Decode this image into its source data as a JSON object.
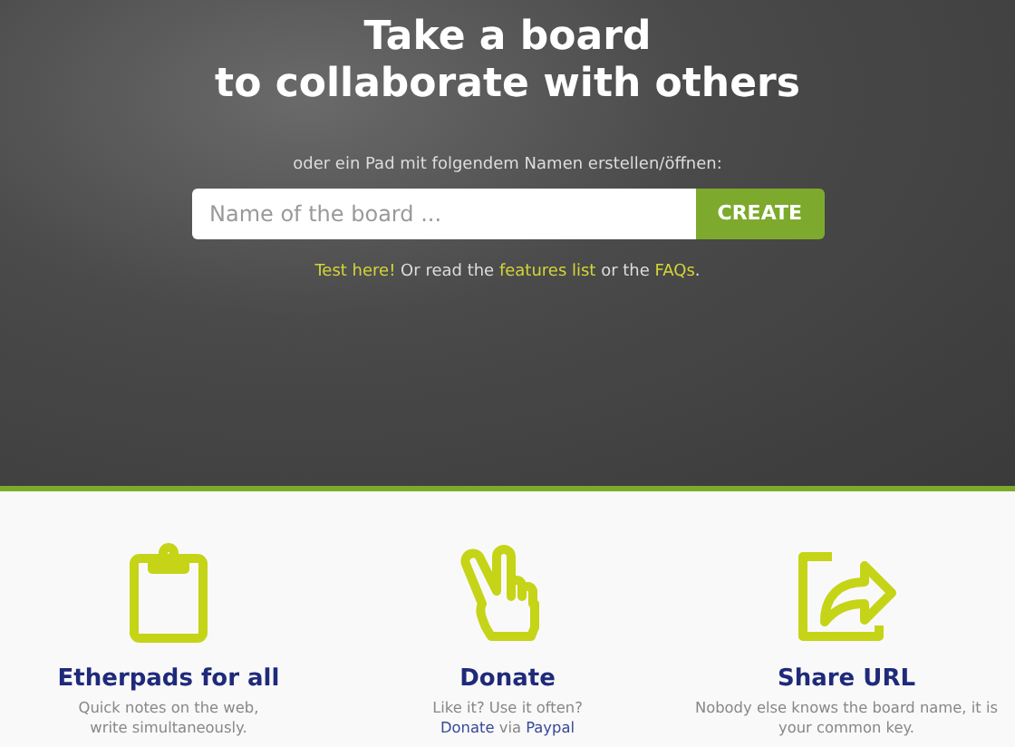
{
  "hero": {
    "title_lines": [
      "Take a board",
      "to collaborate with others"
    ],
    "subtitle": "oder ein Pad mit folgendem Namen erstellen/öffnen:",
    "search": {
      "placeholder": "Name of the board ...",
      "button": "CREATE"
    },
    "links_line": [
      {
        "text": "Test here!",
        "link": true
      },
      {
        "text": " Or read the ",
        "link": false
      },
      {
        "text": "features list",
        "link": true
      },
      {
        "text": " or the ",
        "link": false
      },
      {
        "text": "FAQs",
        "link": true
      },
      {
        "text": ".",
        "link": false
      }
    ]
  },
  "features": [
    {
      "kind": "clipboard",
      "title": "Etherpads for all",
      "paragraphs": [
        [
          {
            "text": "Quick notes on the web, write simultaneously.",
            "link": false
          }
        ]
      ]
    },
    {
      "kind": "hand",
      "title": "Donate",
      "paragraphs": [
        [
          {
            "text": "Like it? Use it often?",
            "link": false
          }
        ],
        [
          {
            "text": "Donate",
            "link": true
          },
          {
            "text": " via ",
            "link": false
          },
          {
            "text": "Paypal",
            "link": true
          }
        ]
      ]
    },
    {
      "kind": "share",
      "title": "Share URL",
      "paragraphs": [
        [
          {
            "text": "Nobody else knows the board name, it is your common key.",
            "link": false
          }
        ]
      ]
    }
  ]
}
